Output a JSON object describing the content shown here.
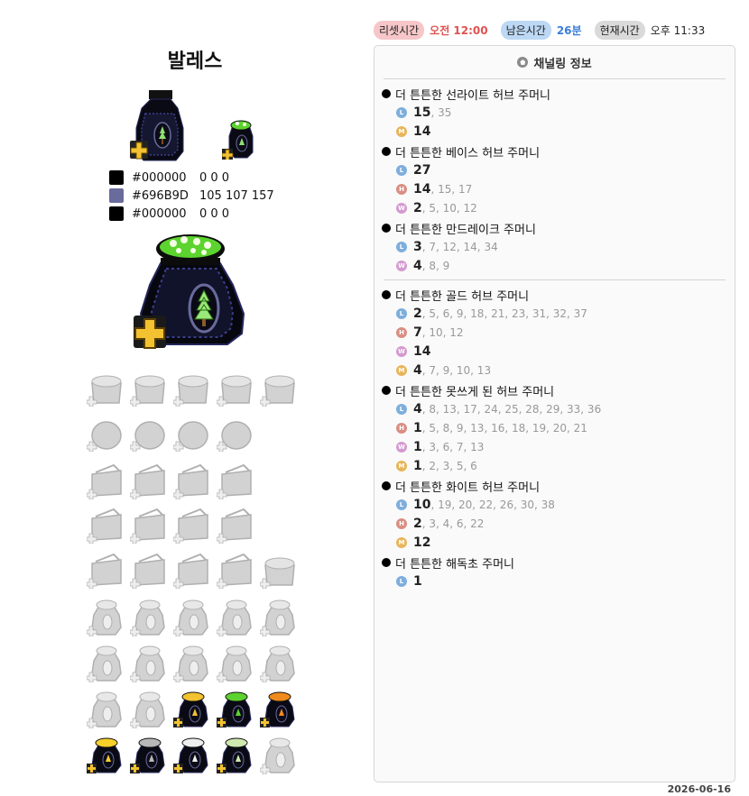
{
  "item_title": "발레스",
  "colors": [
    {
      "hex": "#000000",
      "rgb": "0 0 0",
      "swatch": "#000000"
    },
    {
      "hex": "#696B9D",
      "rgb": "105 107 157",
      "swatch": "#696B9D"
    },
    {
      "hex": "#000000",
      "rgb": "0 0 0",
      "swatch": "#000000"
    }
  ],
  "topbar": {
    "reset_label": "리셋시간",
    "reset_value": "오전 12:00",
    "remain_label": "남은시간",
    "remain_value": "26분",
    "now_label": "현재시간",
    "now_value": "오후 11:33"
  },
  "panel": {
    "title": "채널링 정보",
    "entries": [
      {
        "name": "더 튼튼한 선라이트 허브 주머니",
        "rows": [
          {
            "badge": "L",
            "first": "15",
            "rest": ", 35"
          },
          {
            "badge": "M",
            "first": "14",
            "rest": ""
          }
        ]
      },
      {
        "name": "더 튼튼한 베이스 허브 주머니",
        "rows": [
          {
            "badge": "L",
            "first": "27",
            "rest": ""
          },
          {
            "badge": "H",
            "first": "14",
            "rest": ", 15, 17"
          },
          {
            "badge": "W",
            "first": "2",
            "rest": ", 5, 10, 12"
          }
        ]
      },
      {
        "name": "더 튼튼한 만드레이크 주머니",
        "rows": [
          {
            "badge": "L",
            "first": "3",
            "rest": ", 7, 12, 14, 34"
          },
          {
            "badge": "W",
            "first": "4",
            "rest": ", 8, 9"
          }
        ]
      },
      {
        "name": "더 튼튼한 골드 허브 주머니",
        "rows": [
          {
            "badge": "L",
            "first": "2",
            "rest": ", 5, 6, 9, 18, 21, 23, 31, 32, 37"
          },
          {
            "badge": "H",
            "first": "7",
            "rest": ", 10, 12"
          },
          {
            "badge": "W",
            "first": "14",
            "rest": ""
          },
          {
            "badge": "M",
            "first": "4",
            "rest": ", 7, 9, 10, 13"
          }
        ]
      },
      {
        "name": "더 튼튼한 못쓰게 된 허브 주머니",
        "rows": [
          {
            "badge": "L",
            "first": "4",
            "rest": ", 8, 13, 17, 24, 25, 28, 29, 33, 36"
          },
          {
            "badge": "H",
            "first": "1",
            "rest": ", 5, 8, 9, 13, 16, 18, 19, 20, 21"
          },
          {
            "badge": "W",
            "first": "1",
            "rest": ", 3, 6, 7, 13"
          },
          {
            "badge": "M",
            "first": "1",
            "rest": ", 2, 3, 5, 6"
          }
        ]
      },
      {
        "name": "더 튼튼한 화이트 허브 주머니",
        "rows": [
          {
            "badge": "L",
            "first": "10",
            "rest": ", 19, 20, 22, 26, 30, 38"
          },
          {
            "badge": "H",
            "first": "2",
            "rest": ", 3, 4, 6, 22"
          },
          {
            "badge": "M",
            "first": "12",
            "rest": ""
          }
        ]
      },
      {
        "name": "더 튼튼한 해독초 주머니",
        "rows": [
          {
            "badge": "L",
            "first": "1",
            "rest": ""
          }
        ]
      }
    ]
  },
  "date": "2026-06-16",
  "icon_grid": [
    [
      "eggs-basket-icon",
      "potato-basket-icon",
      "carrot-basket-icon",
      "wheat-basket-icon",
      "herb-basket-icon"
    ],
    [
      "cabbage-sack-icon",
      "cotton-sack-icon",
      "vegetable-sack-icon",
      "onion-sack-icon"
    ],
    [
      "wood-bundle-1-icon",
      "wood-bundle-2-icon",
      "wood-bundle-3-icon",
      "wood-bundle-4-icon"
    ],
    [
      "ore-box-1-icon",
      "ore-box-2-icon",
      "ore-box-3-icon",
      "ore-box-4-icon"
    ],
    [
      "cloth-bundle-1-icon",
      "cloth-bundle-2-icon",
      "cloth-bundle-3-icon",
      "cloth-bundle-4-icon",
      "flower-basket-icon"
    ],
    [
      "herb-pouch-1-icon",
      "herb-pouch-2-icon",
      "herb-pouch-3-icon",
      "herb-pouch-4-icon",
      "herb-pouch-5-icon"
    ],
    [
      "herb-pouch-6-icon",
      "herb-pouch-7-icon",
      "herb-pouch-8-icon",
      "herb-pouch-9-icon",
      "herb-pouch-10-icon"
    ],
    [
      "sturdy-pouch-gray-1-icon",
      "sturdy-pouch-gray-2-icon",
      "sturdy-pouch-gold-icon",
      "sturdy-pouch-green-icon",
      "sturdy-pouch-orange-icon"
    ],
    [
      "sturdy-pouch-yellow-icon",
      "sturdy-pouch-silver-icon",
      "sturdy-pouch-white-icon",
      "sturdy-pouch-mint-icon",
      "sturdy-pouch-gray-3-icon"
    ]
  ],
  "icon_tints": {
    "gold": "#f2c230",
    "green": "#5cd32e",
    "orange": "#f08a1c",
    "yellow": "#f6cf2a",
    "silver": "#b8b8b8",
    "white": "#eeeeee",
    "mint": "#cfe8b0"
  }
}
